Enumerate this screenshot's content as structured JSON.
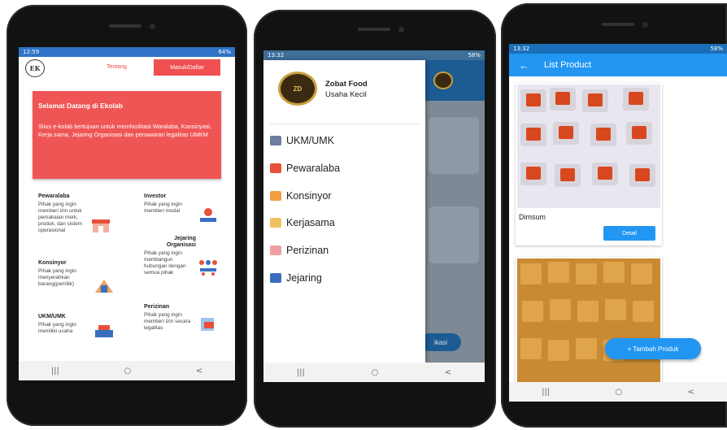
{
  "phone1": {
    "status_time": "12:59",
    "status_battery": "64%",
    "logo_text": "EK",
    "nav_tentang": "Tentang",
    "nav_masuk": "Masuk/Daftar",
    "banner_title": "Selamat Datang di Ekolab",
    "banner_text": "Situs e-kolab bertujuan untuk memfasilitasi Waralaba, Konsinyasi, Kerja sama, Jejaring Organisasi dan penawaran legalitas UMKM",
    "cards": [
      {
        "title": "Pewaralaba",
        "desc": "Pihak yang ingin memberi izin untuk pemakaian merk, produk, dan sistem operasional"
      },
      {
        "title": "Investor",
        "desc": "Pihak yang ingin memberi modal"
      },
      {
        "title": "Jejaring Organisasi",
        "desc": "Pihak yang ingin membangun hubungan dengan semua pihak"
      },
      {
        "title": "Konsinyor",
        "desc": "Pihak yang ingin menyerahkan barang(pemilik)"
      },
      {
        "title": "Perizinan",
        "desc": "Pihak yang ingin memberi izin secara legalitas"
      },
      {
        "title": "UKM/UMK",
        "desc": "Pihak yang ingin memiliki usaha"
      }
    ],
    "nav_icons": [
      "|||",
      "○",
      "<"
    ]
  },
  "phone2": {
    "status_time": "13:32",
    "status_battery": "58%",
    "avatar_text": "ZD",
    "profile_name": "Zobat Food",
    "profile_role": "Usaha Kecil",
    "menu": [
      "UKM/UMK",
      "Pewaralaba",
      "Konsinyor",
      "Kerjasama",
      "Perizinan",
      "Jejaring"
    ],
    "behind_button": "ikasi",
    "nav_icons": [
      "|||",
      "○",
      "<"
    ]
  },
  "phone3": {
    "status_time": "13:32",
    "status_battery": "58%",
    "back_icon": "←",
    "title": "List Product",
    "product_name": "Dimsum",
    "detail_button": "Detail",
    "fab_label": "+ Tambah Produk",
    "nav_icons": [
      "|||",
      "○",
      "<"
    ]
  },
  "colors": {
    "primary_red": "#f05050",
    "primary_blue": "#2196f3",
    "drawer_blue": "#1d5c93"
  }
}
